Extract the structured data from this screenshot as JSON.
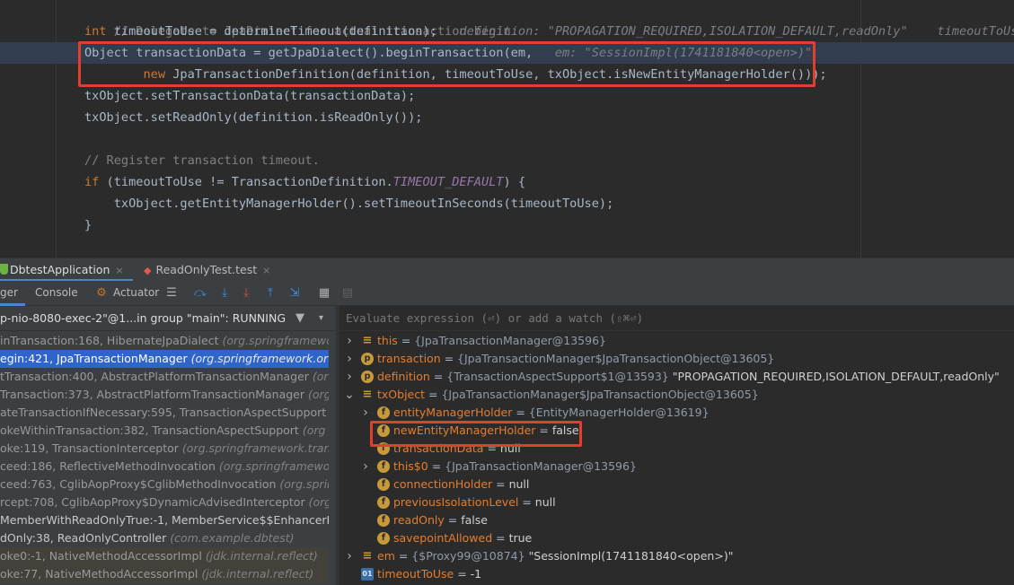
{
  "editor": {
    "lines": {
      "l1_comment": "// Delegate to JpaDialect for actual transaction begin.",
      "l2_kw": "int",
      "l2_code": " timeoutToUse = determineTimeout(definition);",
      "l2_inline": "definition: \"PROPAGATION_REQUIRED,ISOLATION_DEFAULT,readOnly\"    timeoutToUse: ",
      "l3_code": "Object transactionData = getJpaDialect().beginTransaction(em,",
      "l3_inline": "em: \"SessionImpl(1741181840<open>)\"",
      "l4_kw": "new",
      "l4_code": " JpaTransactionDefinition(definition, timeoutToUse, txObject.isNewEntityManagerHolder()));",
      "l5_code": "txObject.setTransactionData(transactionData);",
      "l6_code": "txObject.setReadOnly(definition.isReadOnly());",
      "l8_comment": "// Register transaction timeout.",
      "l9_kw": "if",
      "l9_code_a": " (timeoutToUse != TransactionDefinition.",
      "l9_const": "TIMEOUT_DEFAULT",
      "l9_code_b": ") {",
      "l10_code": "txObject.getEntityManagerHolder().setTimeoutInSeconds(timeoutToUse);",
      "l11_code": "}"
    }
  },
  "tabs": [
    {
      "label": "DbtestApplication",
      "close": "×"
    },
    {
      "label": "ReadOnlyTest.test",
      "close": "×"
    }
  ],
  "toolbar": {
    "debugger_label": "ger",
    "console_label": "Console",
    "actuator_label": "Actuator"
  },
  "thread": {
    "label": "p-nio-8080-exec-2\"@1...in group \"main\": RUNNING"
  },
  "frames": [
    {
      "method": "inTransaction:168, HibernateJpaDialect",
      "pkg": "(org.springframewo"
    },
    {
      "method": "egin:421, JpaTransactionManager",
      "pkg": "(org.springframework.or"
    },
    {
      "method": "tTransaction:400, AbstractPlatformTransactionManager",
      "pkg": "(org"
    },
    {
      "method": "Transaction:373, AbstractPlatformTransactionManager",
      "pkg": "(org"
    },
    {
      "method": "ateTransactionIfNecessary:595, TransactionAspectSupport",
      "pkg": ""
    },
    {
      "method": "okeWithinTransaction:382, TransactionAspectSupport",
      "pkg": "(org"
    },
    {
      "method": "oke:119, TransactionInterceptor",
      "pkg": "(org.springframework.trans"
    },
    {
      "method": "ceed:186, ReflectiveMethodInvocation",
      "pkg": "(org.springframewor"
    },
    {
      "method": "ceed:763, CglibAopProxy$CglibMethodInvocation",
      "pkg": "(org.spring"
    },
    {
      "method": "rcept:708, CglibAopProxy$DynamicAdvisedInterceptor",
      "pkg": "(org"
    },
    {
      "method": "MemberWithReadOnlyTrue:-1, MemberService$$EnhancerBy",
      "pkg": ""
    },
    {
      "method": "dOnly:38, ReadOnlyController",
      "pkg": "(com.example.dbtest)"
    },
    {
      "method": "oke0:-1, NativeMethodAccessorImpl",
      "pkg": "(jdk.internal.reflect)"
    },
    {
      "method": "oke:77, NativeMethodAccessorImpl",
      "pkg": "(jdk.internal.reflect)"
    }
  ],
  "evaluate": {
    "placeholder": "Evaluate expression (⏎) or add a watch (⇧⌘⏎)"
  },
  "variables": [
    {
      "name": "this",
      "type": "{JpaTransactionManager@13596}",
      "value": ""
    },
    {
      "name": "transaction",
      "type": "{JpaTransactionManager$JpaTransactionObject@13605}",
      "value": ""
    },
    {
      "name": "definition",
      "type": "{TransactionAspectSupport$1@13593}",
      "value": "\"PROPAGATION_REQUIRED,ISOLATION_DEFAULT,readOnly\""
    },
    {
      "name": "txObject",
      "type": "{JpaTransactionManager$JpaTransactionObject@13605}",
      "value": ""
    },
    {
      "name": "entityManagerHolder",
      "type": "{EntityManagerHolder@13619}",
      "value": ""
    },
    {
      "name": "newEntityManagerHolder",
      "type": "",
      "value": "false"
    },
    {
      "name": "transactionData",
      "type": "",
      "value": "null"
    },
    {
      "name": "this$0",
      "type": "{JpaTransactionManager@13596}",
      "value": ""
    },
    {
      "name": "connectionHolder",
      "type": "",
      "value": "null"
    },
    {
      "name": "previousIsolationLevel",
      "type": "",
      "value": "null"
    },
    {
      "name": "readOnly",
      "type": "",
      "value": "false"
    },
    {
      "name": "savepointAllowed",
      "type": "",
      "value": "true"
    },
    {
      "name": "em",
      "type": "{$Proxy99@10874}",
      "value": "\"SessionImpl(1741181840<open>)\""
    },
    {
      "name": "timeoutToUse",
      "type": "",
      "value": "-1"
    }
  ],
  "icons": {
    "field": "f",
    "param": "p",
    "primitive": "01",
    "list": "≡"
  },
  "colors": {
    "highlight_box": "#e2402f",
    "selected_frame": "#2f65ca",
    "field_icon": "#c69a3b"
  }
}
